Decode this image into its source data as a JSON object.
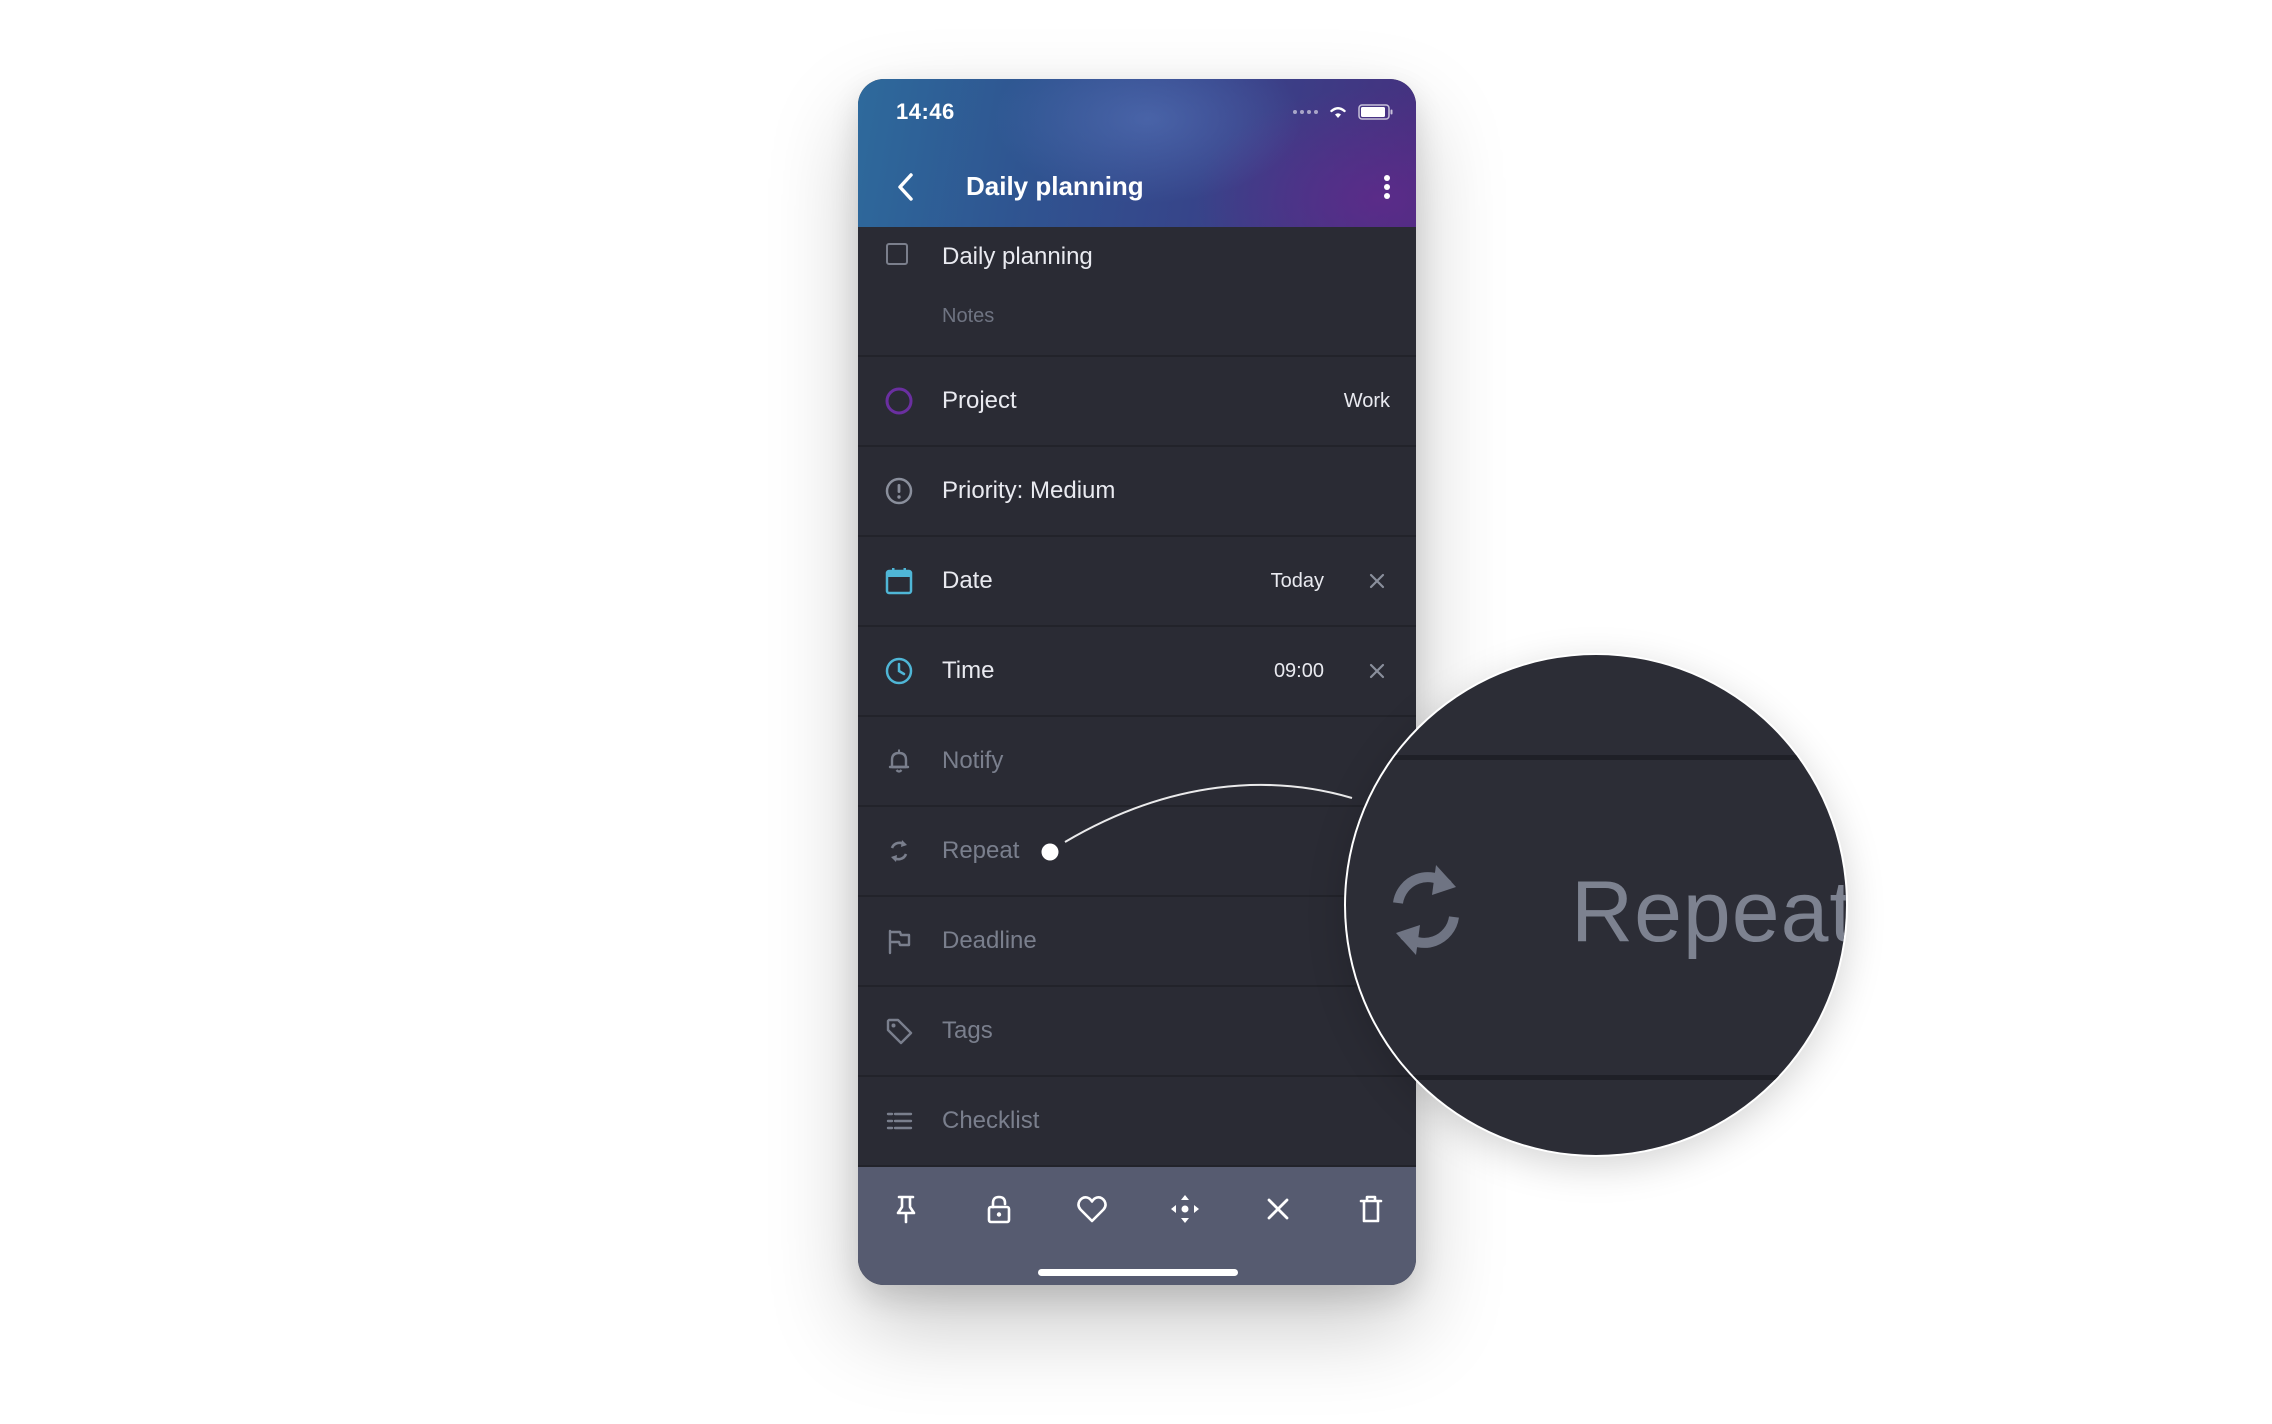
{
  "status_bar": {
    "time": "14:46"
  },
  "header": {
    "title": "Daily planning"
  },
  "task": {
    "title": "Daily planning",
    "notes_placeholder": "Notes"
  },
  "rows": {
    "project": {
      "label": "Project",
      "value": "Work"
    },
    "priority": {
      "label": "Priority: Medium"
    },
    "date": {
      "label": "Date",
      "value": "Today"
    },
    "time": {
      "label": "Time",
      "value": "09:00"
    },
    "notify": {
      "label": "Notify"
    },
    "repeat": {
      "label": "Repeat"
    },
    "deadline": {
      "label": "Deadline"
    },
    "tags": {
      "label": "Tags"
    },
    "checklist": {
      "label": "Checklist"
    }
  },
  "magnifier": {
    "label": "Repeat"
  },
  "colors": {
    "accent_cyan": "#4fb6d6",
    "project_purple": "#6a2fa0",
    "background": "#2a2b34",
    "toolbar": "#565b70"
  },
  "icons": {
    "toolbar": [
      "pin-icon",
      "lock-icon",
      "heart-icon",
      "move-icon",
      "close-icon",
      "trash-icon"
    ]
  }
}
